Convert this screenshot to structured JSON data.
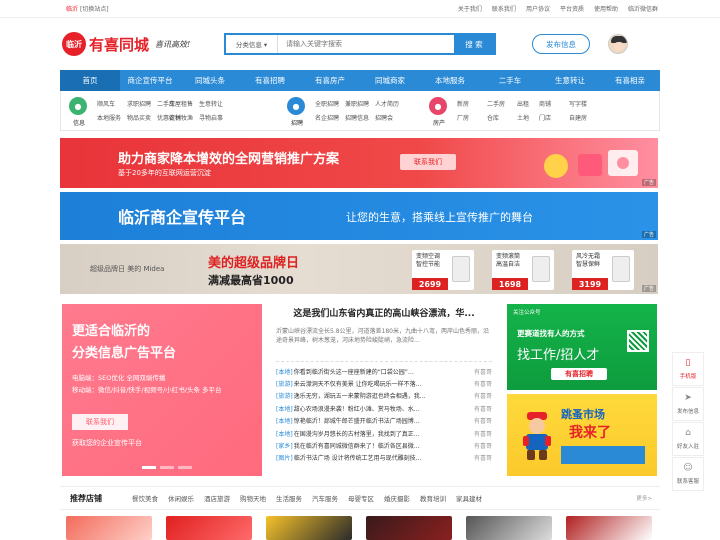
{
  "topbar": {
    "city": "临沂",
    "switch": "[切换站点]",
    "links": [
      "关于我们",
      "联系我们",
      "用户协议",
      "平台资质",
      "使用帮助",
      "临沂微信群"
    ]
  },
  "header": {
    "logo_badge": "临沂",
    "logo_name": "有喜同城",
    "slogan": "喜讯高效!",
    "search_category": "分类信息 ▾",
    "search_placeholder": "请输入关键字搜索",
    "search_button": "搜 索",
    "post_button": "发布信息"
  },
  "nav": [
    "首页",
    "商企宣传平台",
    "同城头条",
    "有喜招聘",
    "有喜房产",
    "同城商家",
    "本地服务",
    "二手车",
    "生意转让",
    "有喜相亲"
  ],
  "categories": [
    {
      "label": "信息",
      "icon": "info-icon",
      "color": "#3cb371",
      "subs": [
        "顺风车",
        "求职招聘",
        "二手车",
        "本地服务",
        "物品买卖",
        "优惠促销"
      ]
    },
    {
      "label": "",
      "icon": "",
      "color": "",
      "subs": [
        "房屋租售",
        "生意转让",
        "农林牧渔",
        "寻物启事"
      ]
    },
    {
      "label": "招聘",
      "icon": "briefcase-icon",
      "color": "#2a8ad6",
      "subs": [
        "全职招聘",
        "兼职招聘",
        "人才简历",
        "名企招聘",
        "招聘信息",
        "招聘会"
      ]
    },
    {
      "label": "房产",
      "icon": "house-icon",
      "color": "#e8456b",
      "subs": [
        "新房",
        "二手房",
        "出租",
        "厂房",
        "仓库",
        "土地"
      ]
    },
    {
      "label": "",
      "icon": "",
      "color": "",
      "subs": [
        "商铺",
        "写字楼",
        "门店",
        "自建房"
      ]
    }
  ],
  "banners": {
    "b1_title": "助力商家降本增效的全网营销推广方案",
    "b1_sub": "基于20多年的互联网运营沉淀",
    "b1_cta": "联系我们",
    "b2_title": "临沂商企宣传平台",
    "b2_sub": "让您的生意，搭乘线上宣传推广的舞台",
    "b3_brand": "超级品牌日  美的 Midea",
    "b3_title": "美的超级品牌日",
    "b3_sub": "满减最高省1000",
    "products": [
      {
        "lbl": "变频空调\n智控节能",
        "price": "2699"
      },
      {
        "lbl": "变频滚筒\n高温自洁",
        "price": "1698"
      },
      {
        "lbl": "风冷无霜\n智慧保鲜",
        "price": "3199"
      }
    ],
    "ad_tag": "广告"
  },
  "left_ad": {
    "h1": "更适合临沂的",
    "h2": "分类信息广告平台",
    "lines": [
      "电脑端：SEO优化 全网双端传播",
      "移动端：微信/抖音/快手/视频号/小红书/头条 多平台"
    ],
    "cta": "联系我们",
    "foot": "获取您的企业宣传平台"
  },
  "news": {
    "headline": "这是我们山东省内真正的高山峡谷漂流，华...",
    "summary": "沂蒙山峡谷漂流全长5.8公里，河道落差180米，九曲十八弯，两岸山色秀丽，沿途奇景异峰，树木葱茏，河床地势险峻陡峭，急流险...",
    "items": [
      {
        "tag": "[本地]",
        "text": "你看到临沂街头这一座座新建的“口袋公园”…",
        "src": "有喜哥"
      },
      {
        "tag": "[旅游]",
        "text": "来云濛洞天不仅有美景 让你吃喝玩乐一样不落…",
        "src": "有喜哥"
      },
      {
        "tag": "[旅游]",
        "text": "逸乐无穷，湖玩五一来蒙阴游逛也终会相遇，我…",
        "src": "有喜哥"
      },
      {
        "tag": "[本地]",
        "text": "甜心农场浪漫来袭！粉红小滩、赏马牧场、水…",
        "src": "有喜哥"
      },
      {
        "tag": "[本地]",
        "text": "惊艳临沂！郯城牛郎芒盛开临沂书法广场园博…",
        "src": "有喜哥"
      },
      {
        "tag": "[本地]",
        "text": "在国漫沟岁月悠长的古村落里，我找到了真正…",
        "src": "有喜哥"
      },
      {
        "tag": "[家乡]",
        "text": "我在临沂有喜同城微信群来了！临沂各区县微…",
        "src": "有喜哥"
      },
      {
        "tag": "[图片]",
        "text": "临沂书法广场 设计将传统工艺用与现代雕刻技…",
        "src": "有喜哥"
      }
    ]
  },
  "right_ad1": {
    "follow": "关注公众号",
    "l1": "更赛道找有人的方式",
    "l2": "找工作/招人才",
    "logo": "有喜招聘"
  },
  "right_ad2": {
    "t1": "跳蚤市场",
    "t2": "我来了"
  },
  "side_tools": [
    {
      "icon": "phone-icon",
      "label": "手机版"
    },
    {
      "icon": "send-icon",
      "label": "发布信息"
    },
    {
      "icon": "group-icon",
      "label": "好友入驻"
    },
    {
      "icon": "service-icon",
      "label": "联系客服"
    }
  ],
  "stores": {
    "title": "推荐店铺",
    "tabs": [
      "餐饮美食",
      "休闲娱乐",
      "酒店旅游",
      "购物天地",
      "生活服务",
      "汽车服务",
      "母婴专区",
      "婚庆摄影",
      "教育培训",
      "家具建材"
    ],
    "more": "更多>"
  },
  "thumbs": [
    {
      "color": "#f26b5b",
      "color2": "#ffd0c8"
    },
    {
      "color": "#e02020",
      "color2": "#ff6a6a"
    },
    {
      "color": "#f6c22a",
      "color2": "#2a2a2a"
    },
    {
      "color": "#3a1a1a",
      "color2": "#8a2020"
    },
    {
      "color": "#555555",
      "color2": "#dddddd"
    },
    {
      "color": "#b02020",
      "color2": "#ffffff"
    }
  ]
}
